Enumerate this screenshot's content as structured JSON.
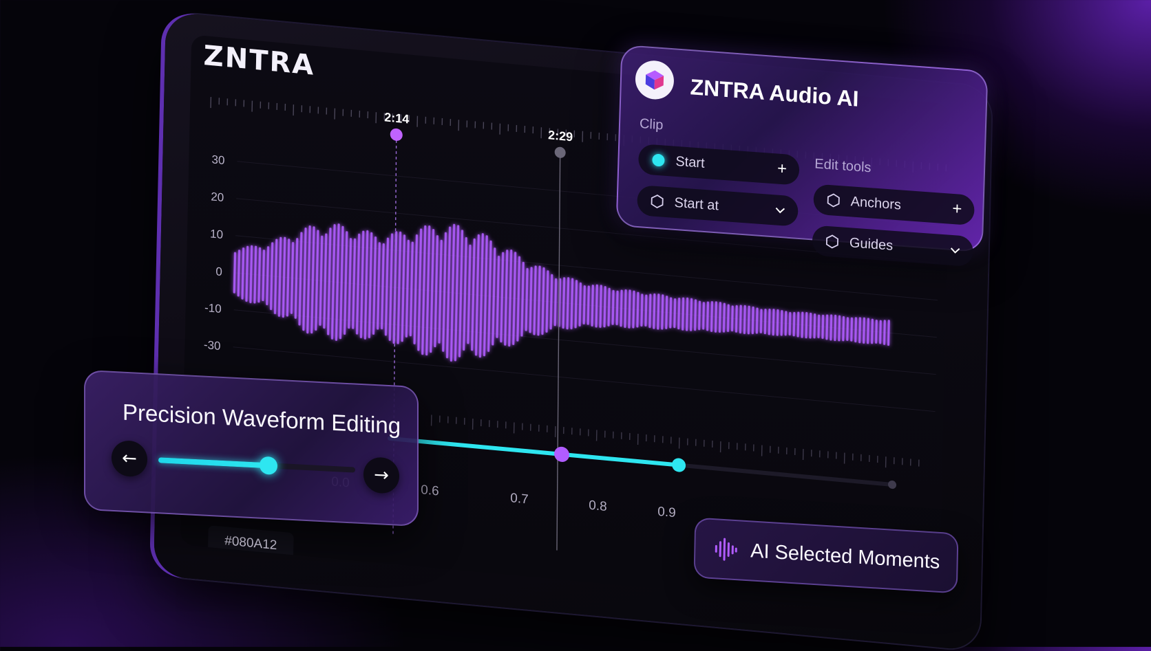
{
  "brand": "ZNTRA",
  "waveform": {
    "y_ticks": [
      "30",
      "20",
      "10",
      "0",
      "-10",
      "-30"
    ],
    "markers": [
      {
        "time": "2:14",
        "color": "#c063ff"
      },
      {
        "time": "2:29",
        "color": "#6b6778"
      }
    ],
    "x_labels": [
      "0.0",
      "0.6",
      "0.7",
      "0.8",
      "0.9"
    ],
    "color_chip": "#080A12",
    "colors": {
      "wave": "#b05cff",
      "timeline": "#2ee6f0"
    }
  },
  "ai_panel": {
    "title": "ZNTRA Audio AI",
    "clip_label": "Clip",
    "edit_tools_label": "Edit tools",
    "clip_items": [
      {
        "label": "Start",
        "lead_icon": "cyan-dot",
        "trail_icon": "plus-icon",
        "trail": "+"
      },
      {
        "label": "Start at",
        "lead_icon": "hexagon-icon",
        "trail_icon": "chevron-down-icon",
        "trail": "⌄"
      }
    ],
    "tool_items": [
      {
        "label": "Anchors",
        "lead_icon": "hexagon-icon",
        "trail_icon": "plus-icon",
        "trail": "+"
      },
      {
        "label": "Guides",
        "lead_icon": "hexagon-icon",
        "trail_icon": "chevron-down-icon",
        "trail": "⌄"
      }
    ]
  },
  "precision_card": {
    "title": "Precision Waveform Editing",
    "prev_icon": "←",
    "next_icon": "→",
    "slider_value_pct": 56
  },
  "moments": {
    "label": "AI Selected Moments"
  }
}
